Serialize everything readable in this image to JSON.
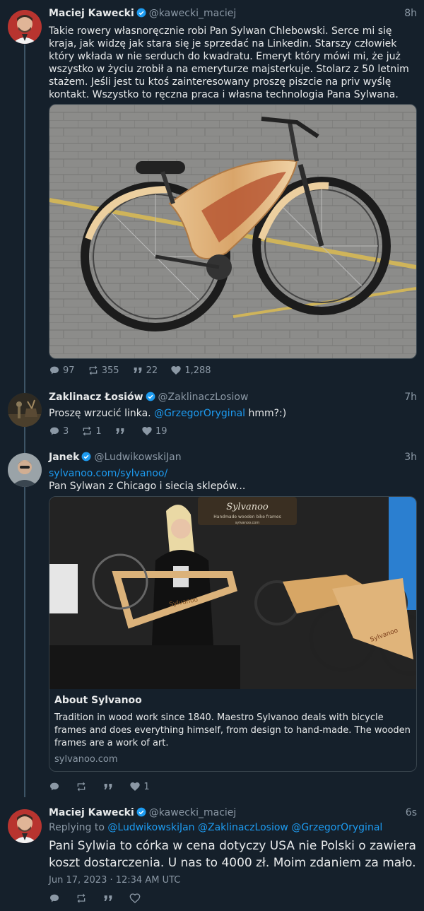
{
  "tweets": [
    {
      "name": "Maciej Kawecki",
      "handle": "@kawecki_maciej",
      "time": "8h",
      "text": "Takie rowery własnoręcznie robi Pan Sylwan Chlebowski. Serce mi się kraja, jak widzę jak stara się je sprzedać na Linkedin. Starszy człowiek który wkłada w nie serduch do kwadratu. Emeryt który mówi mi, że już wszystko w życiu zrobił a na emeryturze majsterkuje. Stolarz z 50 letnim stażem. Jeśli jest tu ktoś zainteresowany proszę piszcie na priv wyślę kontakt. Wszystko to ręczna praca i własna technologia Pana Sylwana.",
      "replies": "97",
      "retweets": "355",
      "quotes": "22",
      "likes": "1,288"
    },
    {
      "name": "Zaklinacz Łosiów",
      "handle": "@ZaklinaczLosiow",
      "time": "7h",
      "text_before": "Proszę wrzucić linka. ",
      "mention": "@GrzegorOryginal",
      "text_after": " hmm?:)",
      "replies": "3",
      "retweets": "1",
      "quotes": "",
      "likes": "19"
    },
    {
      "name": "Janek",
      "handle": "@LudwikowskiJan",
      "time": "3h",
      "link": "sylvanoo.com/sylvanoo/",
      "text": "Pan Sylwan z Chicago i siecią sklepów...",
      "card": {
        "banner": "Sylvanoo",
        "banner_sub": "Handmade wooden bike frames",
        "banner_url": "sylvanoo.com",
        "frame_brand": "Sylvanoo",
        "title": "About Sylvanoo",
        "description": "Tradition in wood work since 1840. Maestro Sylvanoo deals with bicycle frames and does everything himself, from design to hand-made. The wooden frames are a work of art.",
        "domain": "sylvanoo.com"
      },
      "replies": "",
      "retweets": "",
      "quotes": "",
      "likes": "1"
    },
    {
      "name": "Maciej Kawecki",
      "handle": "@kawecki_maciej",
      "time": "6s",
      "replying_label": "Replying to",
      "replying_to": [
        "@LudwikowskiJan",
        "@ZaklinaczLosiow",
        "@GrzegorOryginal"
      ],
      "text": "Pani Sylwia to córka w cena dotyczy USA nie Polski o zawiera koszt dostarczenia. U nas to 4000 zł. Moim zdaniem za mało.",
      "timestamp": "Jun 17, 2023 · 12:34 AM UTC"
    }
  ],
  "colors": {
    "background": "#15202b",
    "accent": "#1d9bf0",
    "muted": "#8b98a5",
    "text": "#e7e9ea"
  },
  "icons": [
    "verified-icon",
    "reply-icon",
    "retweet-icon",
    "quote-icon",
    "like-icon"
  ]
}
